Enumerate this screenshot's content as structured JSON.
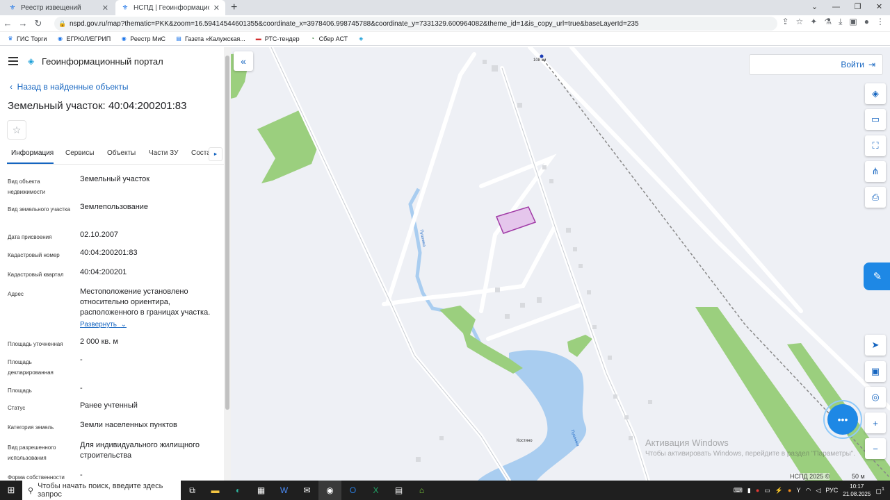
{
  "browser": {
    "tabs": [
      {
        "title": "Реестр извещений",
        "active": false
      },
      {
        "title": "НСПД | Геоинформационный п",
        "active": true
      }
    ],
    "new_tab": "+",
    "url": "nspd.gov.ru/map?thematic=PKK&zoom=16.59414544601355&coordinate_x=3978406.998745788&coordinate_y=7331329.600964082&theme_id=1&is_copy_url=true&baseLayerId=235",
    "bookmarks": [
      "ГИС Торги",
      "ЕГРЮЛ/ЕГРИП",
      "Реестр МиС",
      "Газета «Калужская...",
      "РТС-тендер",
      "Сбер АСТ"
    ]
  },
  "portal": {
    "name": "Геоинформационный портал"
  },
  "back_link": "Назад в найденные объекты",
  "object_title": "Земельный участок: 40:04:200201:83",
  "tabs": [
    "Информация",
    "Сервисы",
    "Объекты",
    "Части ЗУ",
    "Соста"
  ],
  "props": [
    {
      "key": "Вид объекта недвижимости",
      "value": "Земельный участок"
    },
    {
      "key": "Вид земельного участка",
      "value": "Землепользование"
    },
    {
      "key": "Дата присвоения",
      "value": "02.10.2007"
    },
    {
      "key": "Кадастровый номер",
      "value": "40:04:200201:83"
    },
    {
      "key": "Кадастровый квартал",
      "value": "40:04:200201"
    },
    {
      "key": "Адрес",
      "value": "Местоположение установлено относительно ориентира, расположенного в границах участка."
    },
    {
      "key": "Площадь уточненная",
      "value": "2 000 кв. м"
    },
    {
      "key": "Площадь декларированная",
      "value": "-"
    },
    {
      "key": "Площадь",
      "value": "-"
    },
    {
      "key": "Статус",
      "value": "Ранее учтенный"
    },
    {
      "key": "Категория земель",
      "value": "Земли населенных пунктов"
    },
    {
      "key": "Вид разрешенного использования",
      "value": "Для индивидуального жилищного строительства"
    },
    {
      "key": "Форма собственности",
      "value": "-"
    }
  ],
  "expand_link": "Развернуть",
  "map": {
    "login": "Войти",
    "km_label": "108 км",
    "village": "Костино",
    "river": "Пушника",
    "copyright": "НСПД 2025 ©",
    "scale": "50 м",
    "watermark_title": "Активация Windows",
    "watermark_text": "Чтобы активировать Windows, перейдите в раздел \"Параметры\".",
    "colors": {
      "forest": "#9bcf7e",
      "water": "#a9cdf0",
      "parcel_fill": "#e5c6ec",
      "parcel_stroke": "#a03aa6",
      "accent": "#1565c0"
    }
  },
  "taskbar": {
    "search_placeholder": "Чтобы начать поиск, введите здесь запрос",
    "lang": "РУС",
    "time": "10:17",
    "date": "21.08.2025",
    "notif": "1"
  }
}
